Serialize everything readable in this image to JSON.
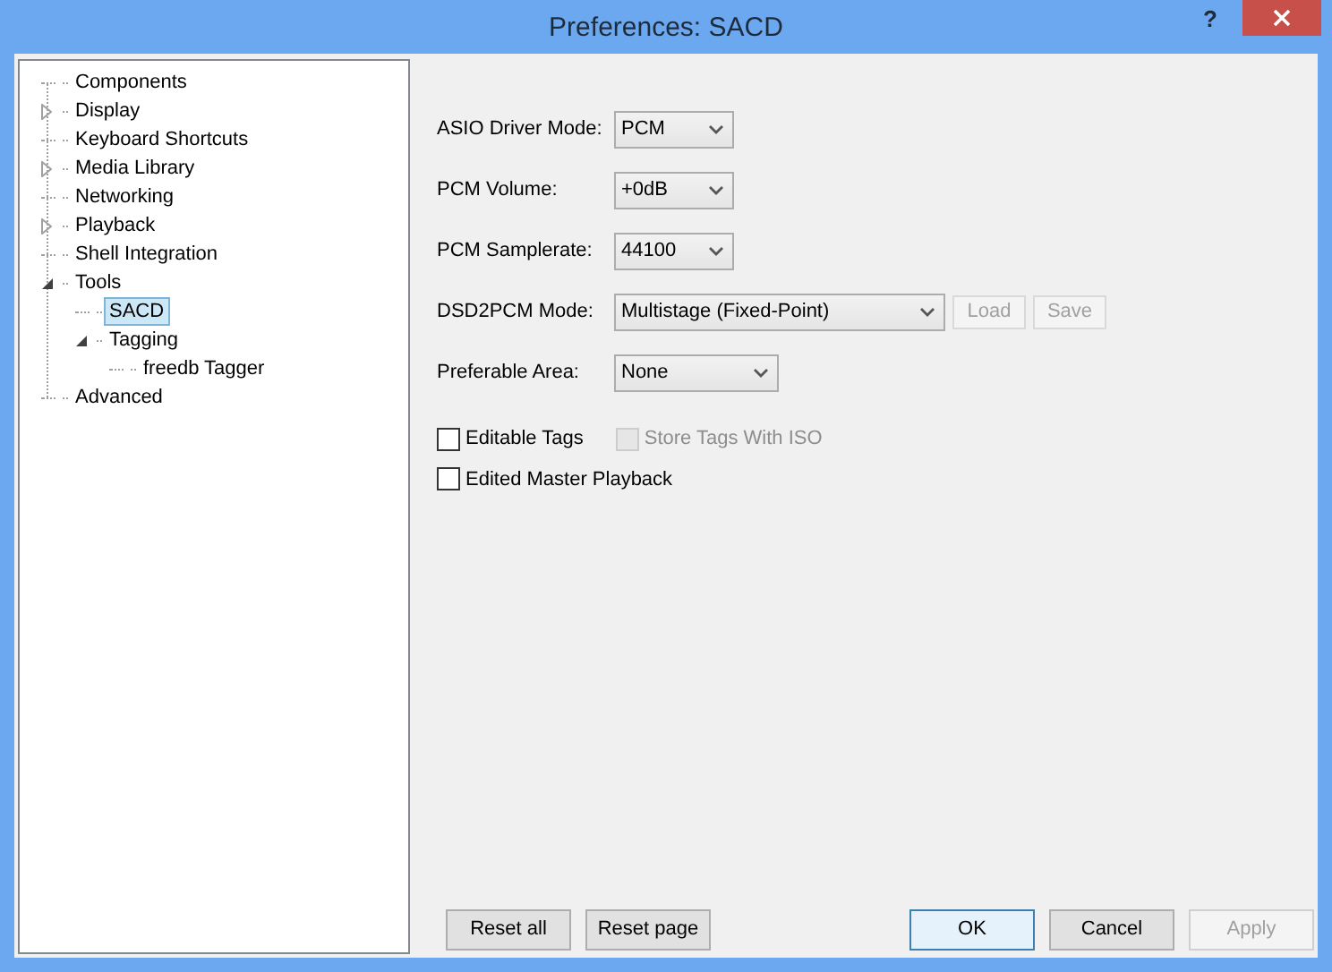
{
  "window": {
    "title": "Preferences: SACD",
    "help": "?"
  },
  "tree": [
    {
      "label": "Components",
      "kind": "leaf",
      "selected": false
    },
    {
      "label": "Display",
      "kind": "collapsed",
      "selected": false
    },
    {
      "label": "Keyboard Shortcuts",
      "kind": "leaf",
      "selected": false
    },
    {
      "label": "Media Library",
      "kind": "collapsed",
      "selected": false
    },
    {
      "label": "Networking",
      "kind": "leaf",
      "selected": false
    },
    {
      "label": "Playback",
      "kind": "collapsed",
      "selected": false
    },
    {
      "label": "Shell Integration",
      "kind": "leaf",
      "selected": false
    },
    {
      "label": "Tools",
      "kind": "expanded",
      "selected": false,
      "children": [
        {
          "label": "SACD",
          "kind": "leaf",
          "selected": true
        },
        {
          "label": "Tagging",
          "kind": "expanded",
          "selected": false,
          "children": [
            {
              "label": "freedb Tagger",
              "kind": "leaf",
              "selected": false
            }
          ]
        }
      ]
    },
    {
      "label": "Advanced",
      "kind": "leaf",
      "selected": false
    }
  ],
  "settings": [
    {
      "label": "ASIO Driver Mode:",
      "value": "PCM"
    },
    {
      "label": "PCM Volume:",
      "value": "+0dB"
    },
    {
      "label": "PCM Samplerate:",
      "value": "44100"
    },
    {
      "label": "DSD2PCM Mode:",
      "value": "Multistage (Fixed-Point)",
      "buttons": [
        {
          "label": "Load",
          "disabled": true
        },
        {
          "label": "Save",
          "disabled": true
        }
      ]
    },
    {
      "label": "Preferable Area:",
      "value": "None"
    }
  ],
  "checkbox_rows": [
    [
      {
        "label": "Editable Tags",
        "checked": false,
        "disabled": false
      },
      {
        "label": "Store Tags With ISO",
        "checked": false,
        "disabled": true
      }
    ],
    [
      {
        "label": "Edited Master Playback",
        "checked": false,
        "disabled": false
      }
    ]
  ],
  "left_buttons": [
    {
      "label": "Reset all",
      "default": false,
      "disabled": false
    },
    {
      "label": "Reset page",
      "default": false,
      "disabled": false
    }
  ],
  "right_buttons": [
    {
      "label": "OK",
      "default": true,
      "disabled": false
    },
    {
      "label": "Cancel",
      "default": false,
      "disabled": false
    },
    {
      "label": "Apply",
      "default": false,
      "disabled": true
    }
  ]
}
